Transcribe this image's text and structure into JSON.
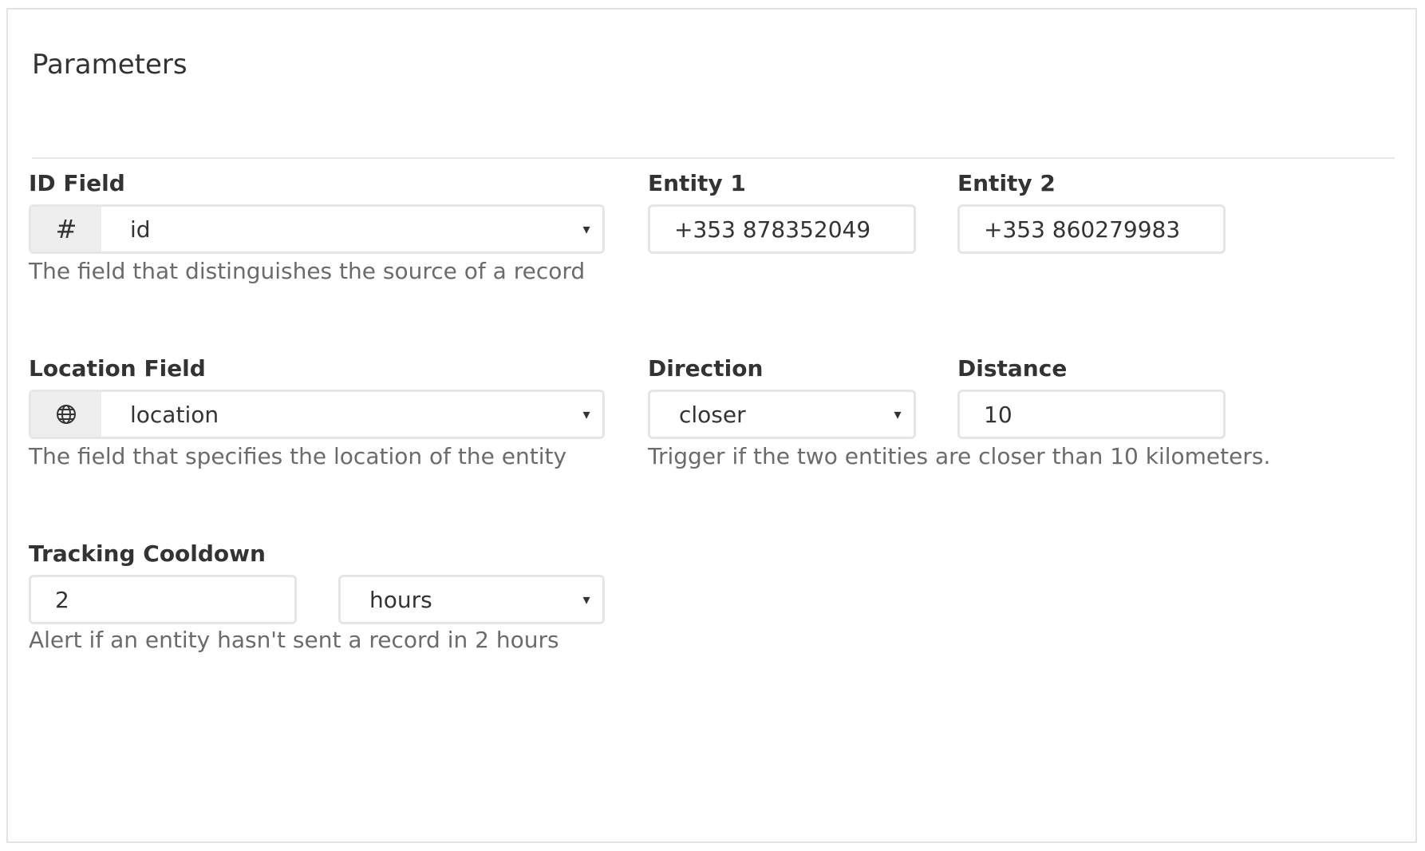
{
  "panel": {
    "title": "Parameters"
  },
  "id_field": {
    "label": "ID Field",
    "addon_symbol": "#",
    "addon_icon": "hash-icon",
    "value": "id",
    "help": "The field that distinguishes the source of a record"
  },
  "entity1": {
    "label": "Entity 1",
    "value": "+353 878352049"
  },
  "entity2": {
    "label": "Entity 2",
    "value": "+353 860279983"
  },
  "location_field": {
    "label": "Location Field",
    "addon_icon": "globe-icon",
    "value": "location",
    "help": "The field that specifies the location of the entity"
  },
  "direction": {
    "label": "Direction",
    "value": "closer"
  },
  "distance": {
    "label": "Distance",
    "value": "10",
    "help": "Trigger if the two entities are closer than 10 kilometers."
  },
  "tracking_cooldown": {
    "label": "Tracking Cooldown",
    "value": "2",
    "unit": "hours",
    "help": "Alert if an entity hasn't sent a record in 2 hours"
  },
  "caret_symbol": "▾"
}
